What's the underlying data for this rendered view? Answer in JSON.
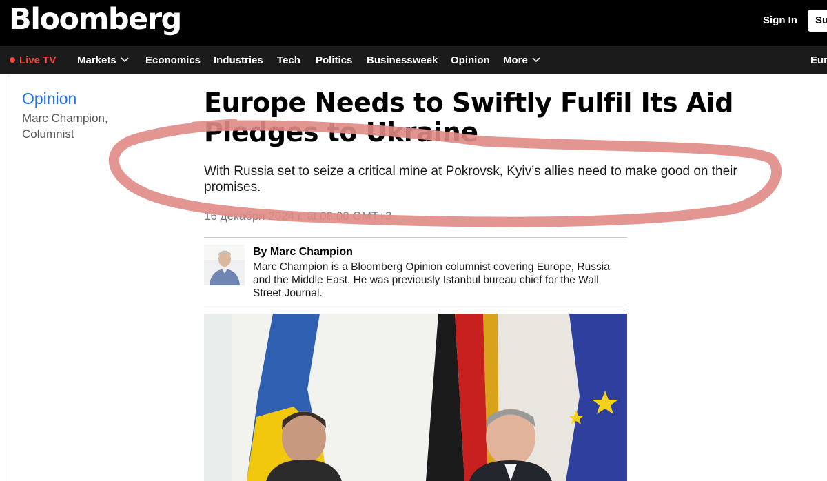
{
  "masthead": {
    "logo": "Bloomberg",
    "signin_label": "Sign In",
    "subscribe_label": "Su"
  },
  "nav": {
    "live_label": "Live TV",
    "items": [
      "Markets",
      "Economics",
      "Industries",
      "Tech",
      "Politics",
      "Businessweek",
      "Opinion",
      "More"
    ],
    "edition_label": "Eur"
  },
  "sidebar": {
    "section": "Opinion",
    "author_line1": "Marc Champion,",
    "author_line2": "Columnist"
  },
  "article": {
    "headline": "Europe Needs to Swiftly Fulfil Its Aid Pledges to Ukraine",
    "dek": "With Russia set to seize a critical mine at Pokrovsk, Kyiv’s allies need to make good on their promises.",
    "timestamp": "16 декабря 2024 г. at 08:00 GMT+3"
  },
  "author": {
    "by": "By",
    "name": "Marc Champion",
    "bio": "Marc Champion is a Bloomberg Opinion columnist covering Europe, Russia and the Middle East. He was previously Istanbul bureau chief for the Wall Street Journal."
  },
  "colors": {
    "live_accent": "#ff433d",
    "opinion_link": "#1f6feb",
    "annotation_marker": "#e08a86"
  },
  "icons": {
    "live": "live-dot-icon",
    "dropdown": "chevron-down-icon"
  }
}
